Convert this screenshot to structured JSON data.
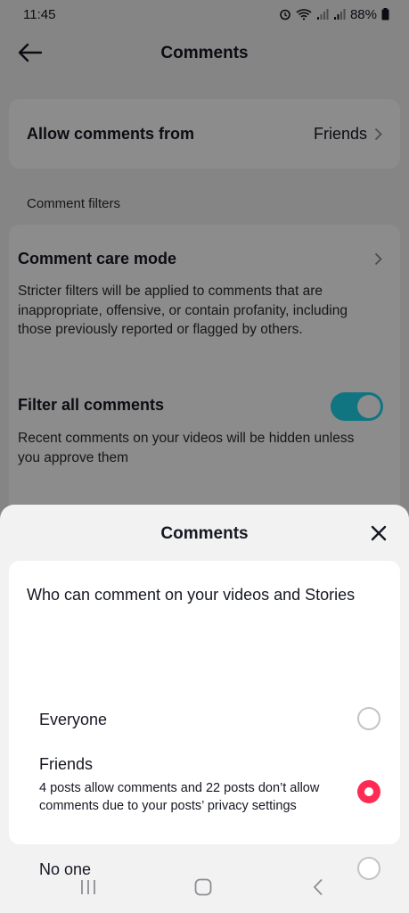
{
  "status_bar": {
    "time": "11:45",
    "battery": "88%",
    "icons": [
      "alarm-icon",
      "wifi-icon",
      "signal-icon",
      "signal-icon",
      "battery-icon"
    ]
  },
  "header": {
    "title": "Comments",
    "back_icon": "arrow-left-icon"
  },
  "allow_comments": {
    "label": "Allow comments from",
    "value": "Friends"
  },
  "comment_filters": {
    "section_title": "Comment filters",
    "care_mode": {
      "title": "Comment care mode",
      "description": "Stricter filters will be applied to comments that are inappropriate, offensive, or contain profanity, including those previously reported or flagged by others."
    },
    "filter_all": {
      "title": "Filter all comments",
      "description": "Recent comments on your videos will be hidden unless you approve them",
      "enabled": true
    }
  },
  "sheet": {
    "title": "Comments",
    "question": "Who can comment on your videos and Stories",
    "options": [
      {
        "label": "Everyone",
        "sublabel": "",
        "selected": false
      },
      {
        "label": "Friends",
        "sublabel": "4 posts allow comments and 22 posts don’t allow comments due to your posts’ privacy settings",
        "selected": true
      },
      {
        "label": "No one",
        "sublabel": "",
        "selected": false
      }
    ]
  },
  "nav_bar": {
    "buttons": [
      "recent-apps-icon",
      "home-icon",
      "back-icon"
    ]
  },
  "colors": {
    "accent_red": "#fe2c55",
    "toggle_teal": "#20d5ec",
    "scrim": "rgba(0,0,0,0.45)"
  }
}
